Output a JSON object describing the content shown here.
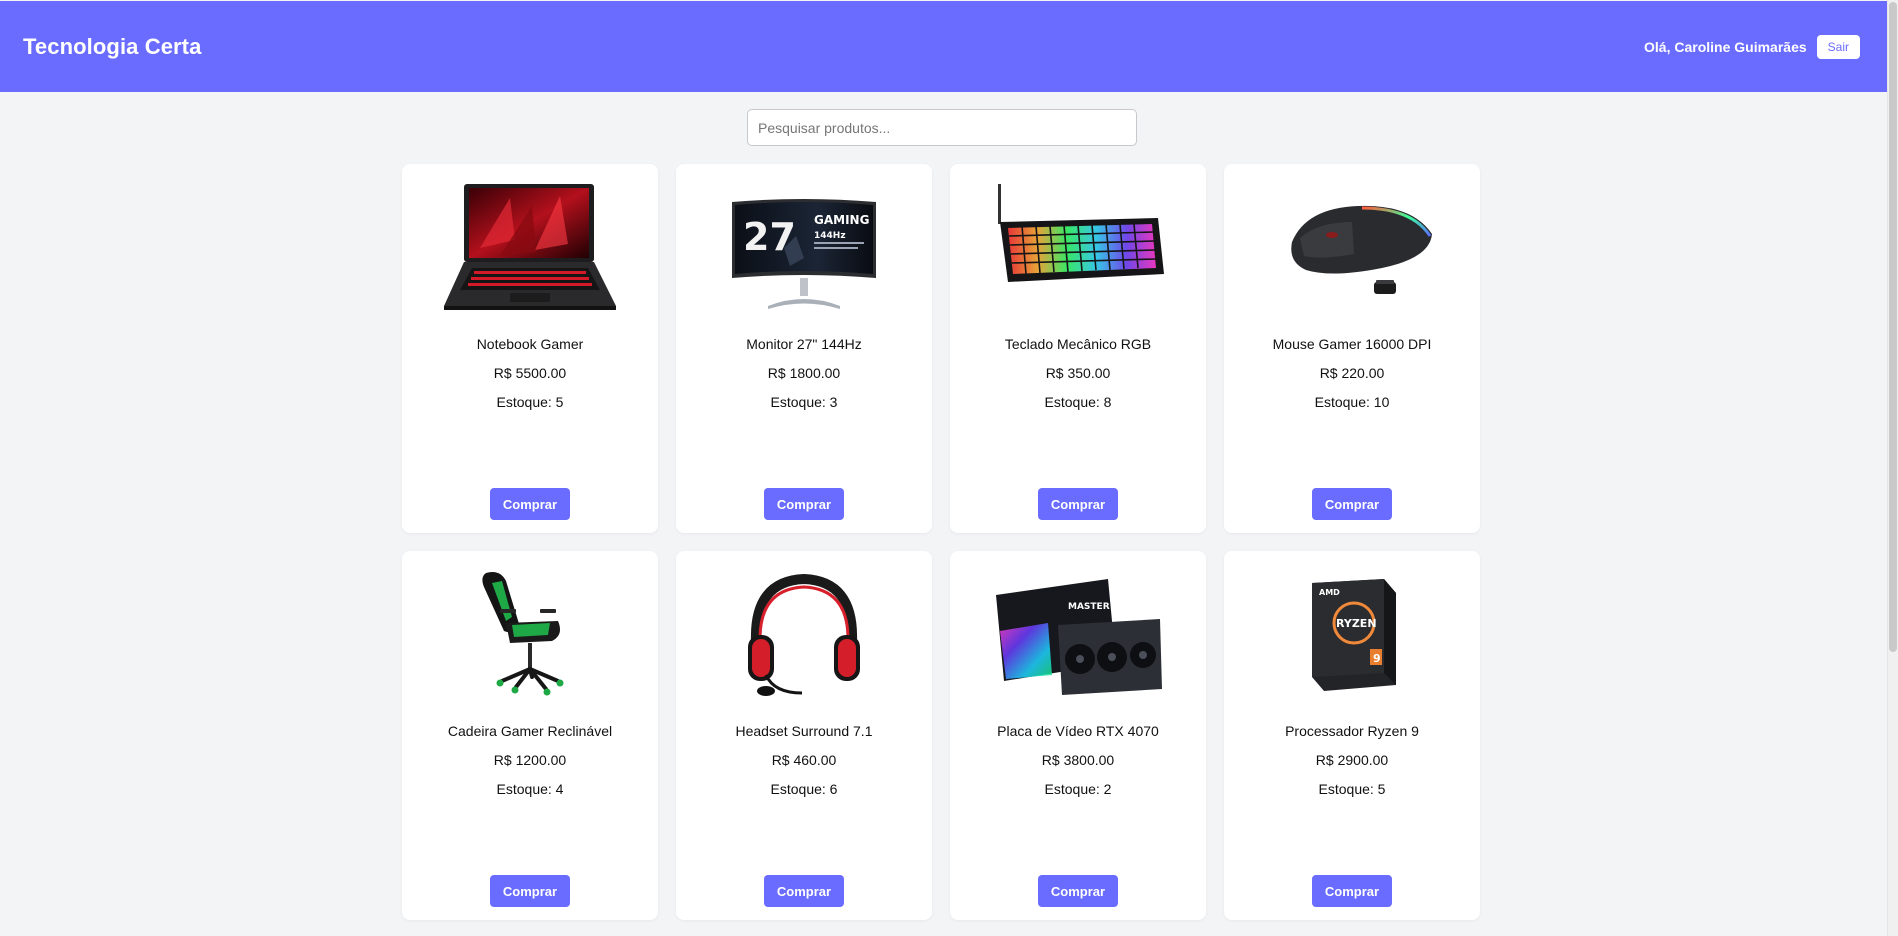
{
  "header": {
    "brand": "Tecnologia Certa",
    "greeting": "Olá, Caroline Guimarães",
    "logout_label": "Sair",
    "accent_color": "#6a6cff"
  },
  "search": {
    "placeholder": "Pesquisar produtos...",
    "value": ""
  },
  "products": [
    {
      "name": "Notebook Gamer",
      "price": "R$ 5500.00",
      "stock": "Estoque: 5",
      "buy_label": "Comprar",
      "image": "laptop-image"
    },
    {
      "name": "Monitor 27\" 144Hz",
      "price": "R$ 1800.00",
      "stock": "Estoque: 3",
      "buy_label": "Comprar",
      "image": "monitor-image",
      "image_text": {
        "big": "27",
        "line1": "GAMING",
        "line2": "144Hz"
      }
    },
    {
      "name": "Teclado Mecânico RGB",
      "price": "R$ 350.00",
      "stock": "Estoque: 8",
      "buy_label": "Comprar",
      "image": "keyboard-image"
    },
    {
      "name": "Mouse Gamer 16000 DPI",
      "price": "R$ 220.00",
      "stock": "Estoque: 10",
      "buy_label": "Comprar",
      "image": "mouse-image"
    },
    {
      "name": "Cadeira Gamer Reclinável",
      "price": "R$ 1200.00",
      "stock": "Estoque: 4",
      "buy_label": "Comprar",
      "image": "chair-image"
    },
    {
      "name": "Headset Surround 7.1",
      "price": "R$ 460.00",
      "stock": "Estoque: 6",
      "buy_label": "Comprar",
      "image": "headset-image"
    },
    {
      "name": "Placa de Vídeo RTX 4070",
      "price": "R$ 3800.00",
      "stock": "Estoque: 2",
      "buy_label": "Comprar",
      "image": "gpu-image",
      "image_text": {
        "box": "MASTER"
      }
    },
    {
      "name": "Processador Ryzen 9",
      "price": "R$ 2900.00",
      "stock": "Estoque: 5",
      "buy_label": "Comprar",
      "image": "cpu-image",
      "image_text": {
        "brand": "AMD",
        "model": "RYZEN",
        "tier": "9"
      }
    }
  ]
}
